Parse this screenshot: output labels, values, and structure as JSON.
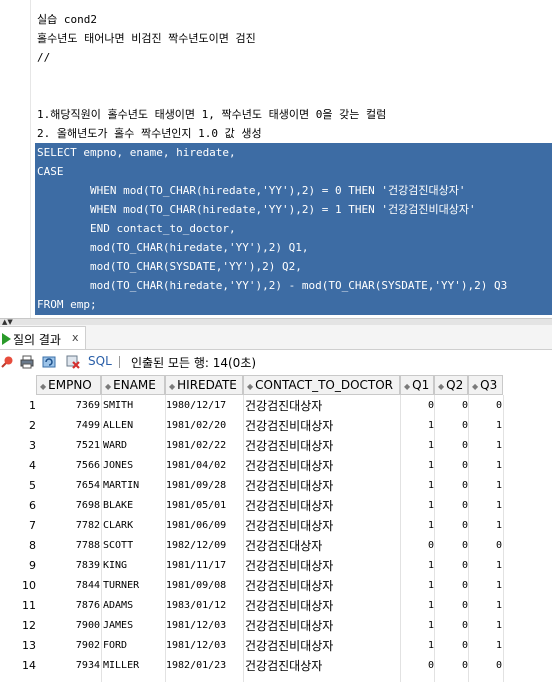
{
  "editor": {
    "lines_plain": [
      "실습 cond2",
      "홀수년도 태어나면 비검진 짝수년도이면 검진",
      "//",
      "",
      "",
      "1.해당직원이 홀수년도 태생이면 1, 짝수년도 태생이면 0을 갖는 컬럼",
      "2. 올해년도가 홀수 짝수년인지 1.0 값 생성"
    ],
    "lines_selected": [
      "SELECT empno, ename, hiredate,",
      "CASE",
      "        WHEN mod(TO_CHAR(hiredate,'YY'),2) = 0 THEN '건강검진대상자'",
      "        WHEN mod(TO_CHAR(hiredate,'YY'),2) = 1 THEN '건강검진비대상자'",
      "        END contact_to_doctor,",
      "        mod(TO_CHAR(hiredate,'YY'),2) Q1,",
      "        mod(TO_CHAR(SYSDATE,'YY'),2) Q2,",
      "        mod(TO_CHAR(hiredate,'YY'),2) - mod(TO_CHAR(SYSDATE,'YY'),2) Q3",
      "FROM emp;"
    ]
  },
  "results_tab": {
    "label": "질의 결과",
    "close": "x"
  },
  "toolbar": {
    "pin_icon": "pin-icon",
    "print_icon": "print-icon",
    "refresh_icon": "refresh-icon",
    "cancel_icon": "cancel-icon",
    "sql_label": "SQL",
    "fetch_status": "인출된 모든 행: 14(0초)"
  },
  "grid": {
    "columns": [
      "EMPNO",
      "ENAME",
      "HIREDATE",
      "CONTACT_TO_DOCTOR",
      "Q1",
      "Q2",
      "Q3"
    ],
    "rows": [
      [
        "1",
        "7369",
        "SMITH",
        "1980/12/17",
        "건강검진대상자",
        "0",
        "0",
        "0"
      ],
      [
        "2",
        "7499",
        "ALLEN",
        "1981/02/20",
        "건강검진비대상자",
        "1",
        "0",
        "1"
      ],
      [
        "3",
        "7521",
        "WARD",
        "1981/02/22",
        "건강검진비대상자",
        "1",
        "0",
        "1"
      ],
      [
        "4",
        "7566",
        "JONES",
        "1981/04/02",
        "건강검진비대상자",
        "1",
        "0",
        "1"
      ],
      [
        "5",
        "7654",
        "MARTIN",
        "1981/09/28",
        "건강검진비대상자",
        "1",
        "0",
        "1"
      ],
      [
        "6",
        "7698",
        "BLAKE",
        "1981/05/01",
        "건강검진비대상자",
        "1",
        "0",
        "1"
      ],
      [
        "7",
        "7782",
        "CLARK",
        "1981/06/09",
        "건강검진비대상자",
        "1",
        "0",
        "1"
      ],
      [
        "8",
        "7788",
        "SCOTT",
        "1982/12/09",
        "건강검진대상자",
        "0",
        "0",
        "0"
      ],
      [
        "9",
        "7839",
        "KING",
        "1981/11/17",
        "건강검진비대상자",
        "1",
        "0",
        "1"
      ],
      [
        "10",
        "7844",
        "TURNER",
        "1981/09/08",
        "건강검진비대상자",
        "1",
        "0",
        "1"
      ],
      [
        "11",
        "7876",
        "ADAMS",
        "1983/01/12",
        "건강검진비대상자",
        "1",
        "0",
        "1"
      ],
      [
        "12",
        "7900",
        "JAMES",
        "1981/12/03",
        "건강검진비대상자",
        "1",
        "0",
        "1"
      ],
      [
        "13",
        "7902",
        "FORD",
        "1981/12/03",
        "건강검진비대상자",
        "1",
        "0",
        "1"
      ],
      [
        "14",
        "7934",
        "MILLER",
        "1982/01/23",
        "건강검진대상자",
        "0",
        "0",
        "0"
      ]
    ]
  },
  "colors": {
    "selection": "#3d6ca4",
    "tab_icon": "#2a9a2a",
    "sql_link": "#2a5fa8"
  }
}
